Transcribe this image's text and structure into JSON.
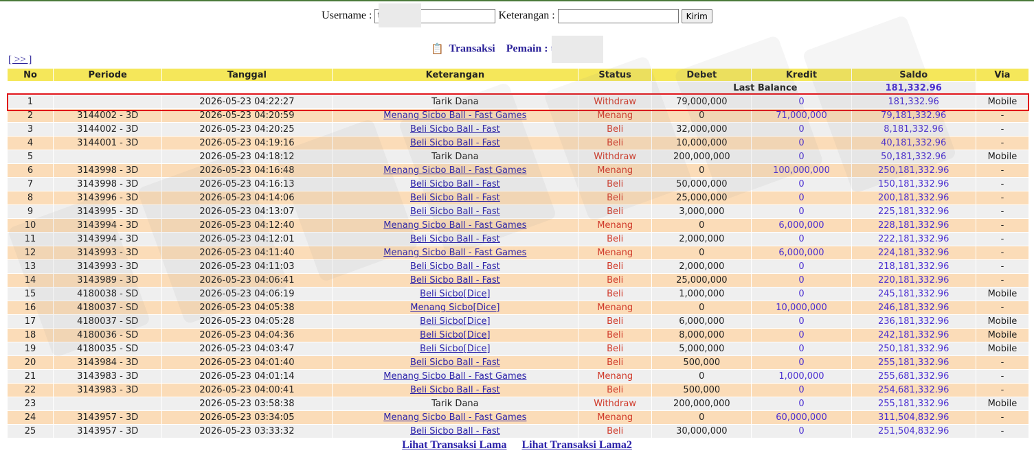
{
  "form": {
    "username_label": "Username :",
    "username_value": "t",
    "keterangan_label": "Keterangan :",
    "keterangan_value": "",
    "submit_label": "Kirim"
  },
  "heading": {
    "title": "Transaksi",
    "player_label": "Pemain : t"
  },
  "nav_link": "[ >> ]",
  "columns": [
    "No",
    "Periode",
    "Tanggal",
    "Keterangan",
    "Status",
    "Debet",
    "Kredit",
    "Saldo",
    "Via"
  ],
  "last_balance": {
    "label": "Last Balance",
    "value": "181,332.96"
  },
  "rows": [
    {
      "no": "1",
      "periode": "",
      "tanggal": "2026-05-23 04:22:27",
      "keterangan": "Tarik Dana",
      "link": false,
      "status": "Withdraw",
      "debet": "79,000,000",
      "kredit": "0",
      "saldo": "181,332.96",
      "via": "Mobile"
    },
    {
      "no": "2",
      "periode": "3144002 - 3D",
      "tanggal": "2026-05-23 04:20:59",
      "keterangan": "Menang Sicbo Ball - Fast Games",
      "link": true,
      "status": "Menang",
      "debet": "0",
      "kredit": "71,000,000",
      "saldo": "79,181,332.96",
      "via": "-"
    },
    {
      "no": "3",
      "periode": "3144002 - 3D",
      "tanggal": "2026-05-23 04:20:25",
      "keterangan": "Beli Sicbo Ball - Fast",
      "link": true,
      "status": "Beli",
      "debet": "32,000,000",
      "kredit": "0",
      "saldo": "8,181,332.96",
      "via": "-"
    },
    {
      "no": "4",
      "periode": "3144001 - 3D",
      "tanggal": "2026-05-23 04:19:16",
      "keterangan": "Beli Sicbo Ball - Fast",
      "link": true,
      "status": "Beli",
      "debet": "10,000,000",
      "kredit": "0",
      "saldo": "40,181,332.96",
      "via": "-"
    },
    {
      "no": "5",
      "periode": "",
      "tanggal": "2026-05-23 04:18:12",
      "keterangan": "Tarik Dana",
      "link": false,
      "status": "Withdraw",
      "debet": "200,000,000",
      "kredit": "0",
      "saldo": "50,181,332.96",
      "via": "Mobile"
    },
    {
      "no": "6",
      "periode": "3143998 - 3D",
      "tanggal": "2026-05-23 04:16:48",
      "keterangan": "Menang Sicbo Ball - Fast Games",
      "link": true,
      "status": "Menang",
      "debet": "0",
      "kredit": "100,000,000",
      "saldo": "250,181,332.96",
      "via": "-"
    },
    {
      "no": "7",
      "periode": "3143998 - 3D",
      "tanggal": "2026-05-23 04:16:13",
      "keterangan": "Beli Sicbo Ball - Fast",
      "link": true,
      "status": "Beli",
      "debet": "50,000,000",
      "kredit": "0",
      "saldo": "150,181,332.96",
      "via": "-"
    },
    {
      "no": "8",
      "periode": "3143996 - 3D",
      "tanggal": "2026-05-23 04:14:06",
      "keterangan": "Beli Sicbo Ball - Fast",
      "link": true,
      "status": "Beli",
      "debet": "25,000,000",
      "kredit": "0",
      "saldo": "200,181,332.96",
      "via": "-"
    },
    {
      "no": "9",
      "periode": "3143995 - 3D",
      "tanggal": "2026-05-23 04:13:07",
      "keterangan": "Beli Sicbo Ball - Fast",
      "link": true,
      "status": "Beli",
      "debet": "3,000,000",
      "kredit": "0",
      "saldo": "225,181,332.96",
      "via": "-"
    },
    {
      "no": "10",
      "periode": "3143994 - 3D",
      "tanggal": "2026-05-23 04:12:40",
      "keterangan": "Menang Sicbo Ball - Fast Games",
      "link": true,
      "status": "Menang",
      "debet": "0",
      "kredit": "6,000,000",
      "saldo": "228,181,332.96",
      "via": "-"
    },
    {
      "no": "11",
      "periode": "3143994 - 3D",
      "tanggal": "2026-05-23 04:12:01",
      "keterangan": "Beli Sicbo Ball - Fast",
      "link": true,
      "status": "Beli",
      "debet": "2,000,000",
      "kredit": "0",
      "saldo": "222,181,332.96",
      "via": "-"
    },
    {
      "no": "12",
      "periode": "3143993 - 3D",
      "tanggal": "2026-05-23 04:11:40",
      "keterangan": "Menang Sicbo Ball - Fast Games",
      "link": true,
      "status": "Menang",
      "debet": "0",
      "kredit": "6,000,000",
      "saldo": "224,181,332.96",
      "via": "-"
    },
    {
      "no": "13",
      "periode": "3143993 - 3D",
      "tanggal": "2026-05-23 04:11:03",
      "keterangan": "Beli Sicbo Ball - Fast",
      "link": true,
      "status": "Beli",
      "debet": "2,000,000",
      "kredit": "0",
      "saldo": "218,181,332.96",
      "via": "-"
    },
    {
      "no": "14",
      "periode": "3143989 - 3D",
      "tanggal": "2026-05-23 04:06:41",
      "keterangan": "Beli Sicbo Ball - Fast",
      "link": true,
      "status": "Beli",
      "debet": "25,000,000",
      "kredit": "0",
      "saldo": "220,181,332.96",
      "via": "-"
    },
    {
      "no": "15",
      "periode": "4180038 - SD",
      "tanggal": "2026-05-23 04:06:19",
      "keterangan": "Beli Sicbo[Dice]",
      "link": true,
      "status": "Beli",
      "debet": "1,000,000",
      "kredit": "0",
      "saldo": "245,181,332.96",
      "via": "Mobile"
    },
    {
      "no": "16",
      "periode": "4180037 - SD",
      "tanggal": "2026-05-23 04:05:38",
      "keterangan": "Menang Sicbo[Dice]",
      "link": true,
      "status": "Menang",
      "debet": "0",
      "kredit": "10,000,000",
      "saldo": "246,181,332.96",
      "via": "-"
    },
    {
      "no": "17",
      "periode": "4180037 - SD",
      "tanggal": "2026-05-23 04:05:28",
      "keterangan": "Beli Sicbo[Dice]",
      "link": true,
      "status": "Beli",
      "debet": "6,000,000",
      "kredit": "0",
      "saldo": "236,181,332.96",
      "via": "Mobile"
    },
    {
      "no": "18",
      "periode": "4180036 - SD",
      "tanggal": "2026-05-23 04:04:36",
      "keterangan": "Beli Sicbo[Dice]",
      "link": true,
      "status": "Beli",
      "debet": "8,000,000",
      "kredit": "0",
      "saldo": "242,181,332.96",
      "via": "Mobile"
    },
    {
      "no": "19",
      "periode": "4180035 - SD",
      "tanggal": "2026-05-23 04:03:47",
      "keterangan": "Beli Sicbo[Dice]",
      "link": true,
      "status": "Beli",
      "debet": "5,000,000",
      "kredit": "0",
      "saldo": "250,181,332.96",
      "via": "Mobile"
    },
    {
      "no": "20",
      "periode": "3143984 - 3D",
      "tanggal": "2026-05-23 04:01:40",
      "keterangan": "Beli Sicbo Ball - Fast",
      "link": true,
      "status": "Beli",
      "debet": "500,000",
      "kredit": "0",
      "saldo": "255,181,332.96",
      "via": "-"
    },
    {
      "no": "21",
      "periode": "3143983 - 3D",
      "tanggal": "2026-05-23 04:01:14",
      "keterangan": "Menang Sicbo Ball - Fast Games",
      "link": true,
      "status": "Menang",
      "debet": "0",
      "kredit": "1,000,000",
      "saldo": "255,681,332.96",
      "via": "-"
    },
    {
      "no": "22",
      "periode": "3143983 - 3D",
      "tanggal": "2026-05-23 04:00:41",
      "keterangan": "Beli Sicbo Ball - Fast",
      "link": true,
      "status": "Beli",
      "debet": "500,000",
      "kredit": "0",
      "saldo": "254,681,332.96",
      "via": "-"
    },
    {
      "no": "23",
      "periode": "",
      "tanggal": "2026-05-23 03:58:38",
      "keterangan": "Tarik Dana",
      "link": false,
      "status": "Withdraw",
      "debet": "200,000,000",
      "kredit": "0",
      "saldo": "255,181,332.96",
      "via": "Mobile"
    },
    {
      "no": "24",
      "periode": "3143957 - 3D",
      "tanggal": "2026-05-23 03:34:05",
      "keterangan": "Menang Sicbo Ball - Fast Games",
      "link": true,
      "status": "Menang",
      "debet": "0",
      "kredit": "60,000,000",
      "saldo": "311,504,832.96",
      "via": "-"
    },
    {
      "no": "25",
      "periode": "3143957 - 3D",
      "tanggal": "2026-05-23 03:33:32",
      "keterangan": "Beli Sicbo Ball - Fast",
      "link": true,
      "status": "Beli",
      "debet": "30,000,000",
      "kredit": "0",
      "saldo": "251,504,832.96",
      "via": "-"
    }
  ],
  "footer": {
    "link1": "Lihat Transaksi Lama",
    "link2": "Lihat Transaksi Lama2"
  },
  "colors": {
    "header_bg": "#f5e75a",
    "row_odd": "#efefef",
    "row_even": "#fbdcb8",
    "status_color": "#d03a2a",
    "link_color": "#2b22aa",
    "highlight_border": "#e0141a"
  },
  "icons": {
    "heading_icon": "document-icon"
  }
}
